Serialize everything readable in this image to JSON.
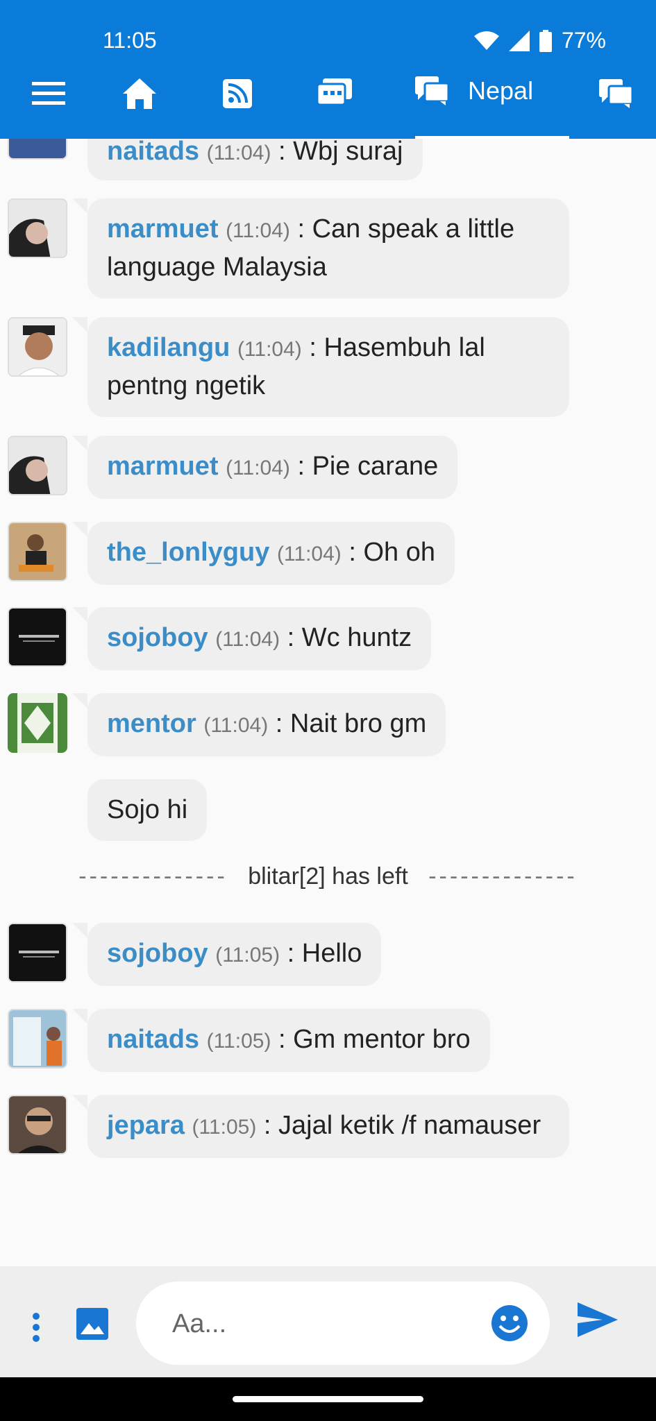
{
  "status": {
    "time": "11:05",
    "battery": "77%"
  },
  "nav": {
    "active_tab_label": "Nepal",
    "icons": [
      "menu-icon",
      "home-icon",
      "feed-icon",
      "rooms-icon",
      "chat-icon",
      "private-chat-icon"
    ]
  },
  "messages": [
    {
      "user": "naitads",
      "time": "(11:04)",
      "text": "Wbj suraj"
    },
    {
      "user": "marmuet",
      "time": "(11:04)",
      "text": "Can speak a little language  Malaysia"
    },
    {
      "user": "kadilangu",
      "time": "(11:04)",
      "text": "Hasembuh lal pentng ngetik"
    },
    {
      "user": "marmuet",
      "time": "(11:04)",
      "text": "Pie carane"
    },
    {
      "user": "the_lonlyguy",
      "time": "(11:04)",
      "text": "Oh oh"
    },
    {
      "user": "sojoboy",
      "time": "(11:04)",
      "text": "Wc huntz"
    },
    {
      "user": "mentor",
      "time": "(11:04)",
      "text": "Nait bro gm"
    },
    {
      "text": "Sojo hi"
    },
    {
      "system": "blitar[2] has left",
      "dashes": "--------------"
    },
    {
      "user": "sojoboy",
      "time": "(11:05)",
      "text": "Hello"
    },
    {
      "user": "naitads",
      "time": "(11:05)",
      "text": "Gm mentor bro"
    },
    {
      "user": "jepara",
      "time": "(11:05)",
      "text": "Jajal ketik /f namauser"
    }
  ],
  "composer": {
    "placeholder": "Aa..."
  },
  "colors": {
    "header": "#0a7bd8",
    "username": "#3b8dc7",
    "bubble": "#efefef",
    "icon_blue": "#1976d2"
  }
}
